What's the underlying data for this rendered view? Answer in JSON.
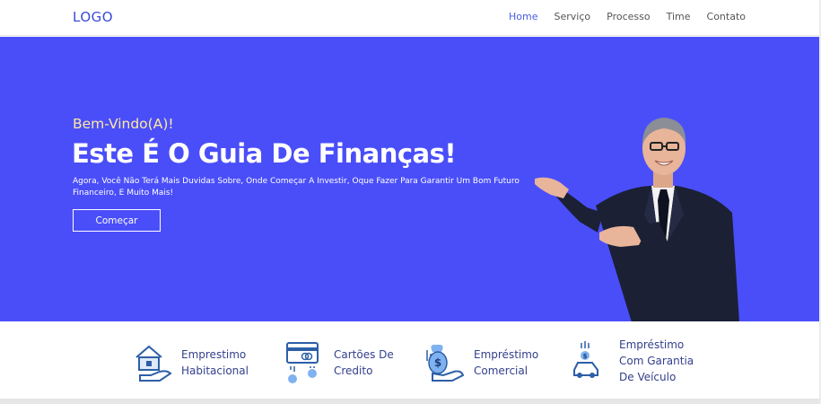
{
  "header": {
    "logo": "LOGO",
    "nav": [
      {
        "label": "Home",
        "active": true
      },
      {
        "label": "Serviço",
        "active": false
      },
      {
        "label": "Processo",
        "active": false
      },
      {
        "label": "Time",
        "active": false
      },
      {
        "label": "Contato",
        "active": false
      }
    ]
  },
  "hero": {
    "greeting": "Bem-Vindo(A)!",
    "headline": "Este É O Guia De Finanças!",
    "subtitle": "Agora, Você Não Terá Mais Duvidas Sobre, Onde Começar A Investir, Oque Fazer Para Garantir Um Bom Futuro Financeiro, E Muito Mais!",
    "cta_label": "Começar"
  },
  "services": [
    {
      "label_lines": [
        "Emprestimo",
        "Habitacional"
      ],
      "icon": "house-loan-icon"
    },
    {
      "label_lines": [
        "Cartões De",
        "Credito"
      ],
      "icon": "credit-card-icon"
    },
    {
      "label_lines": [
        "Empréstimo",
        "Comercial"
      ],
      "icon": "money-bag-hand-icon"
    },
    {
      "label_lines": [
        "Empréstimo",
        "Com Garantia",
        "De Veículo"
      ],
      "icon": "car-loan-icon"
    }
  ],
  "colors": {
    "hero_bg": "#4a4ef9",
    "greeting": "#ffe9a3",
    "accent": "#3a4bd6",
    "service_text": "#34408c"
  }
}
